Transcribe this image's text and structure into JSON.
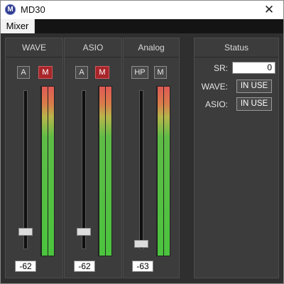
{
  "window": {
    "title": "MD30",
    "icon": "app-logo-icon",
    "icon_letter": "M",
    "close_glyph": "✕"
  },
  "menu": {
    "items": [
      {
        "label": "Mixer"
      }
    ]
  },
  "channels": [
    {
      "header": "WAVE",
      "buttons": [
        "A",
        "M"
      ],
      "active_button": "M",
      "value": "-62",
      "slider_level": 0.08,
      "meter_level_left": 1.0,
      "meter_level_right": 1.0
    },
    {
      "header": "ASIO",
      "buttons": [
        "A",
        "M"
      ],
      "active_button": "M",
      "value": "-62",
      "slider_level": 0.08,
      "meter_level_left": 1.0,
      "meter_level_right": 1.0
    },
    {
      "header": "Analog",
      "buttons": [
        "HP",
        "M"
      ],
      "active_button": null,
      "value": "-63",
      "slider_level": 0.0,
      "meter_level_left": 1.0,
      "meter_level_right": 1.0
    }
  ],
  "status": {
    "header": "Status",
    "sr_label": "SR:",
    "sr_value": "0",
    "wave_label": "WAVE:",
    "wave_status": "IN USE",
    "asio_label": "ASIO:",
    "asio_status": "IN USE"
  },
  "colors": {
    "panel_bg": "#3c3c3c",
    "mute_active": "#a8262a",
    "meter_green": "#4bc43e",
    "meter_red": "#e05a55"
  }
}
